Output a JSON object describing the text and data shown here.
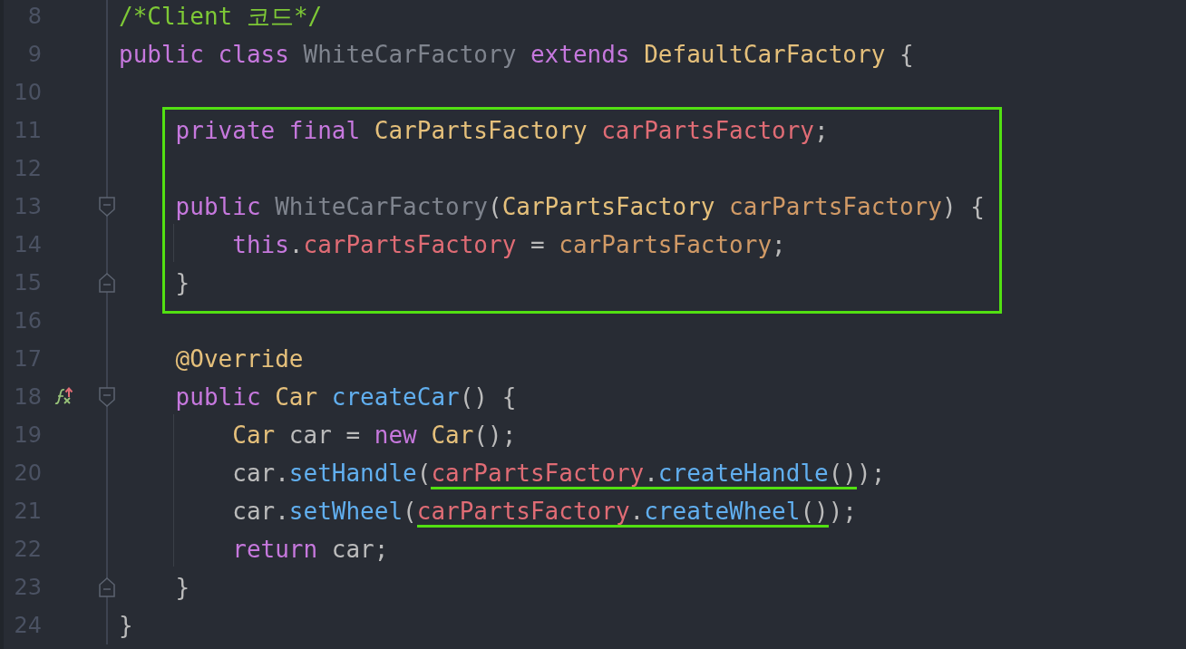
{
  "editor": {
    "lines": [
      {
        "number": "8",
        "tokens": [
          {
            "kind": "comment",
            "text": "/*Client 코드*/"
          }
        ]
      },
      {
        "number": "9",
        "tokens": [
          {
            "kind": "keyword",
            "text": "public class "
          },
          {
            "kind": "unused",
            "text": "WhiteCarFactory "
          },
          {
            "kind": "keyword",
            "text": "extends "
          },
          {
            "kind": "type",
            "text": "DefaultCarFactory "
          },
          {
            "kind": "plain",
            "text": "{"
          }
        ]
      },
      {
        "number": "10"
      },
      {
        "number": "11",
        "boxed": true,
        "tokens": [
          {
            "kind": "keyword",
            "text": "    private final "
          },
          {
            "kind": "type",
            "text": "CarPartsFactory "
          },
          {
            "kind": "field",
            "text": "carPartsFactory"
          },
          {
            "kind": "plain",
            "text": ";"
          }
        ]
      },
      {
        "number": "12",
        "boxed": true
      },
      {
        "number": "13",
        "boxed": true,
        "fold_start": true,
        "tokens": [
          {
            "kind": "keyword",
            "text": "    public "
          },
          {
            "kind": "unused",
            "text": "WhiteCarFactory"
          },
          {
            "kind": "plain",
            "text": "("
          },
          {
            "kind": "type",
            "text": "CarPartsFactory "
          },
          {
            "kind": "param",
            "text": "carPartsFactory"
          },
          {
            "kind": "plain",
            "text": ") {"
          }
        ]
      },
      {
        "number": "14",
        "boxed": true,
        "guide": true,
        "tokens": [
          {
            "kind": "keyword",
            "text": "        this"
          },
          {
            "kind": "plain",
            "text": "."
          },
          {
            "kind": "field",
            "text": "carPartsFactory"
          },
          {
            "kind": "plain",
            "text": " = "
          },
          {
            "kind": "param",
            "text": "carPartsFactory"
          },
          {
            "kind": "plain",
            "text": ";"
          }
        ]
      },
      {
        "number": "15",
        "boxed": true,
        "fold_end": true,
        "tokens": [
          {
            "kind": "plain",
            "text": "    }"
          }
        ]
      },
      {
        "number": "16"
      },
      {
        "number": "17",
        "tokens": [
          {
            "kind": "annotation",
            "text": "    @Override"
          }
        ]
      },
      {
        "number": "18",
        "fold_start": true,
        "override_marker": true,
        "tokens": [
          {
            "kind": "keyword",
            "text": "    public "
          },
          {
            "kind": "type",
            "text": "Car "
          },
          {
            "kind": "method",
            "text": "createCar"
          },
          {
            "kind": "plain",
            "text": "() {"
          }
        ]
      },
      {
        "number": "19",
        "guide": true,
        "tokens": [
          {
            "kind": "type",
            "text": "        Car "
          },
          {
            "kind": "plain",
            "text": "car = "
          },
          {
            "kind": "keyword",
            "text": "new "
          },
          {
            "kind": "type",
            "text": "Car"
          },
          {
            "kind": "plain",
            "text": "();"
          }
        ]
      },
      {
        "number": "20",
        "guide": true,
        "tokens": [
          {
            "kind": "plain",
            "text": "        car."
          },
          {
            "kind": "method",
            "text": "setHandle"
          },
          {
            "kind": "plain",
            "text": "("
          },
          {
            "kind": "field",
            "text": "carPartsFactory",
            "underlined": true
          },
          {
            "kind": "plain",
            "text": ".",
            "underlined": true
          },
          {
            "kind": "method",
            "text": "createHandle",
            "underlined": true
          },
          {
            "kind": "plain",
            "text": "()",
            "underlined": true
          },
          {
            "kind": "plain",
            "text": ");"
          }
        ]
      },
      {
        "number": "21",
        "guide": true,
        "tokens": [
          {
            "kind": "plain",
            "text": "        car."
          },
          {
            "kind": "method",
            "text": "setWheel"
          },
          {
            "kind": "plain",
            "text": "("
          },
          {
            "kind": "field",
            "text": "carPartsFactory",
            "underlined": true
          },
          {
            "kind": "plain",
            "text": ".",
            "underlined": true
          },
          {
            "kind": "method",
            "text": "createWheel",
            "underlined": true
          },
          {
            "kind": "plain",
            "text": "()",
            "underlined": true
          },
          {
            "kind": "plain",
            "text": ");"
          }
        ]
      },
      {
        "number": "22",
        "guide": true,
        "tokens": [
          {
            "kind": "keyword",
            "text": "        return "
          },
          {
            "kind": "plain",
            "text": "car;"
          }
        ]
      },
      {
        "number": "23",
        "fold_end": true,
        "tokens": [
          {
            "kind": "plain",
            "text": "    }"
          }
        ]
      },
      {
        "number": "24",
        "tokens": [
          {
            "kind": "plain",
            "text": "}"
          }
        ]
      }
    ]
  }
}
